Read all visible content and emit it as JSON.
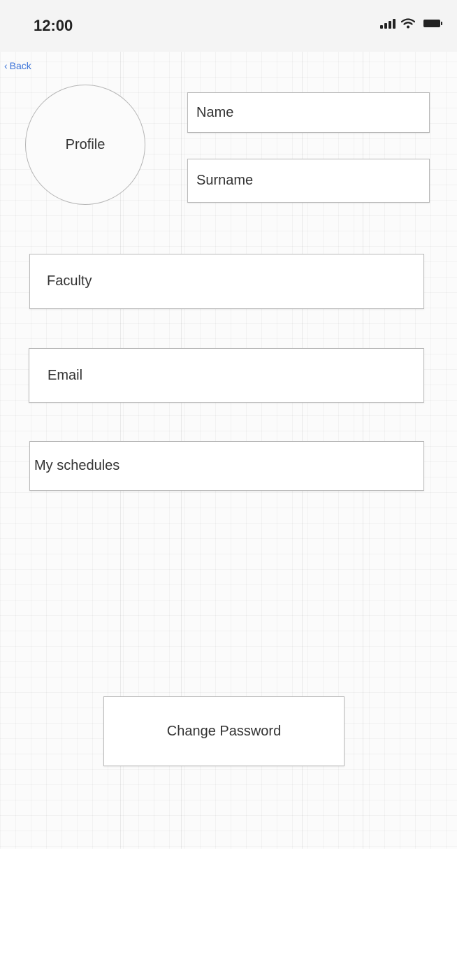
{
  "status_bar": {
    "time": "12:00",
    "icons": [
      "signal-icon",
      "wifi-icon",
      "battery-icon"
    ]
  },
  "nav": {
    "back_label": "Back",
    "back_icon": "chevron-left-icon",
    "accent_color": "#3a72d8"
  },
  "profile": {
    "avatar_label": "Profile",
    "fields": {
      "name": "Name",
      "surname": "Surname",
      "faculty": "Faculty",
      "email": "Email",
      "schedules": "My schedules"
    }
  },
  "actions": {
    "change_password_label": "Change Password"
  }
}
